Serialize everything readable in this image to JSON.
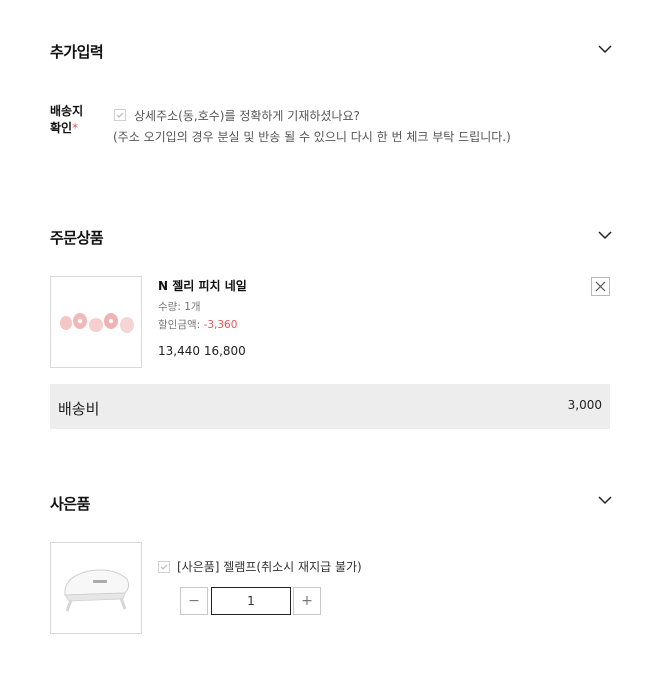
{
  "sections": {
    "extra_input": {
      "title": "추가입력"
    },
    "order_items": {
      "title": "주문상품"
    },
    "gifts": {
      "title": "사은품"
    }
  },
  "extra_input": {
    "field_label_line1": "배송지",
    "field_label_line2": "확인",
    "required_mark": "*",
    "checkbox_label": "상세주소(동,호수)를 정확하게 기재하셨나요?",
    "note": "(주소 오기입의 경우 분실 및 반송 될 수 있으니 다시 한 번 체크 부탁 드립니다.)",
    "checked": true
  },
  "order_item": {
    "name": "N 젤리 피치 네일",
    "quantity_text": "수량: 1개",
    "discount_label": "할인금액:",
    "discount_value": "-3,360",
    "sale_price": "13,440",
    "original_price": "16,800"
  },
  "shipping": {
    "label": "배송비",
    "amount": "3,000"
  },
  "gift": {
    "label": "[사은품] 젤램프(취소시 재지급 불가)",
    "checked": true,
    "quantity": "1",
    "minus": "−",
    "plus": "+"
  },
  "icons": {
    "chevron": "chevron-down-icon",
    "close": "close-icon",
    "check": "check-icon"
  },
  "colors": {
    "accent_red": "#e25757",
    "shipping_bg": "#ededed"
  }
}
